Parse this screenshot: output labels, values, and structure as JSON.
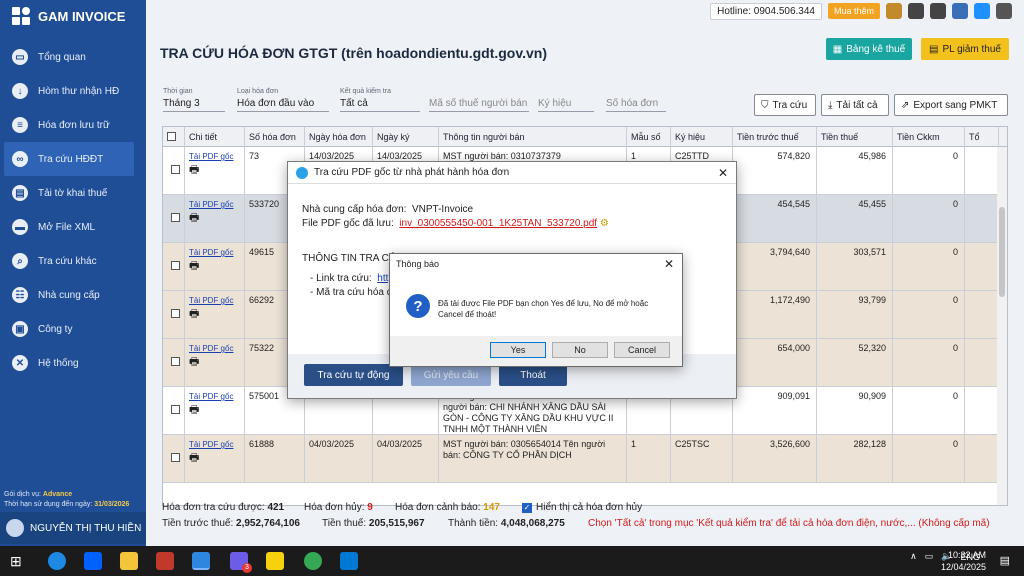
{
  "app": {
    "name": "GAM INVOICE"
  },
  "sidebar": {
    "items": [
      {
        "label": "Tổng quan",
        "icon": "monitor-icon"
      },
      {
        "label": "Hòm thư nhận HĐ",
        "icon": "download-icon"
      },
      {
        "label": "Hóa đơn lưu trữ",
        "icon": "document-icon"
      },
      {
        "label": "Tra cứu HĐĐT",
        "icon": "link-icon"
      },
      {
        "label": "Tải tờ khai thuế",
        "icon": "file-icon"
      },
      {
        "label": "Mở File XML",
        "icon": "folder-icon"
      },
      {
        "label": "Tra cứu khác",
        "icon": "search-icon"
      },
      {
        "label": "Nhà cung cấp",
        "icon": "contacts-icon"
      },
      {
        "label": "Công ty",
        "icon": "building-icon"
      },
      {
        "label": "Hệ thống",
        "icon": "tools-icon"
      }
    ],
    "plan_label": "Gói dịch vụ:",
    "plan_value": "Advance",
    "expiry_label": "Thời hạn sử dụng đến ngày:",
    "expiry_value": "31/03/2026",
    "user_name": "NGUYỄN THỊ THU HIỀN"
  },
  "topbar": {
    "hotline": "Hotline: 0904.506.344",
    "buy": "Mua thêm"
  },
  "page": {
    "title": "TRA CỨU HÓA ĐƠN GTGT (trên hoadondientu.gdt.gov.vn)",
    "btn_bang_ke": "Bảng kê thuế",
    "btn_pl_giam": "PL giảm thuế"
  },
  "filters": {
    "time_label": "Thời gian",
    "time_value": "Tháng 3",
    "type_label": "Loại hóa đơn",
    "type_value": "Hóa đơn đầu vào",
    "result_label": "Kết quả kiểm tra",
    "result_value": "Tất cả",
    "mst_placeholder": "Mã số thuế người bán",
    "kyhieu_placeholder": "Ký hiệu",
    "sohd_placeholder": "Số hóa đơn",
    "btn_search": "Tra cứu",
    "btn_download_all": "Tải tất cả",
    "btn_export": "Export sang PMKT"
  },
  "table": {
    "headers": [
      "Chi tiết",
      "Số hóa đơn",
      "Ngày hóa đơn",
      "Ngày ký",
      "Thông tin người bán",
      "Mẫu số",
      "Ký hiệu",
      "Tiền trước thuế",
      "Tiền thuế",
      "Tiền Ckkm",
      "Tổ"
    ],
    "link_text": "Tải PDF gốc",
    "rows": [
      {
        "so": "73",
        "ngay": "14/03/2025",
        "ky": "14/03/2025",
        "info": "MST người bán: 0310737379",
        "mau": "1",
        "kh": "C25TTD",
        "truoc": "574,820",
        "thue": "45,986",
        "ck": "0",
        "bg": "#ffffff"
      },
      {
        "so": "533720",
        "ngay": "",
        "ky": "",
        "info": "",
        "mau": "",
        "kh": "",
        "truoc": "454,545",
        "thue": "45,455",
        "ck": "0",
        "bg": "#d7dbe2"
      },
      {
        "so": "49615",
        "ngay": "",
        "ky": "",
        "info": "",
        "mau": "",
        "kh": "",
        "truoc": "3,794,640",
        "thue": "303,571",
        "ck": "0",
        "bg": "#ece3d6"
      },
      {
        "so": "66292",
        "ngay": "",
        "ky": "",
        "info": "",
        "mau": "",
        "kh": "",
        "truoc": "1,172,490",
        "thue": "93,799",
        "ck": "0",
        "bg": "#ece3d6"
      },
      {
        "so": "75322",
        "ngay": "",
        "ky": "",
        "info": "",
        "mau": "",
        "kh": "",
        "truoc": "654,000",
        "thue": "52,320",
        "ck": "0",
        "bg": "#ece3d6"
      },
      {
        "so": "575001",
        "ngay": "26/03/2025",
        "ky": "26/03/2025",
        "info": "MST người bán: 0300555450-001 Tên người bán: CHI NHÁNH XĂNG DẦU SÀI GÒN - CÔNG TY XĂNG DẦU KHU VỰC II TNHH MỘT THÀNH VIÊN",
        "mau": "1",
        "kh": "K25TAN",
        "truoc": "909,091",
        "thue": "90,909",
        "ck": "0",
        "bg": "#ffffff"
      },
      {
        "so": "61888",
        "ngay": "04/03/2025",
        "ky": "04/03/2025",
        "info": "MST người bán: 0305654014 Tên người bán: CÔNG TY CỔ PHẦN DỊCH",
        "mau": "1",
        "kh": "C25TSC",
        "truoc": "3,526,600",
        "thue": "282,128",
        "ck": "0",
        "bg": "#ece3d6"
      }
    ]
  },
  "footer": {
    "count_label": "Hóa đơn tra cứu được:",
    "count_value": "421",
    "cancel_label": "Hóa đơn hủy:",
    "cancel_value": "9",
    "warn_label": "Hóa đơn cảnh báo:",
    "warn_value": "147",
    "show_cancel_label": "Hiển thị cả hóa đơn hủy",
    "pre_tax_label": "Tiền trước thuế:",
    "pre_tax_value": "2,952,764,106",
    "tax_label": "Tiền thuế:",
    "tax_value": "205,515,967",
    "total_label": "Thành tiền:",
    "total_value": "4,048,068,275",
    "notice": "Chọn 'Tất cả' trong mục 'Kết quả kiểm tra' để tải cả hóa đơn điện, nước,... (Không cấp mã)"
  },
  "dialog_pdf": {
    "title": "Tra cứu PDF gốc từ nhà phát hành hóa đơn",
    "provider_label": "Nhà cung cấp hóa đơn:",
    "provider_value": "VNPT-Invoice",
    "file_label": "File PDF gốc đã lưu:",
    "file_value": "inv_0300555450-001_1K25TAN_533720.pdf",
    "info_heading": "THÔNG TIN TRA CỨ",
    "link_label": "- Link tra cứu:",
    "link_value": "http",
    "code_label": "- Mã tra cứu hóa đ",
    "btn_auto": "Tra cứu tự động",
    "btn_request": "Gửi yêu cầu",
    "btn_exit": "Thoát"
  },
  "dialog_notice": {
    "title": "Thông báo",
    "message": "Đã tải được File PDF bạn chọn Yes để lưu, No để mở hoặc Cancel để thoát!",
    "yes": "Yes",
    "no": "No",
    "cancel": "Cancel"
  },
  "taskbar": {
    "lang": "ENG",
    "time": "10:32 AM",
    "date": "12/04/2025",
    "badge": "3"
  }
}
